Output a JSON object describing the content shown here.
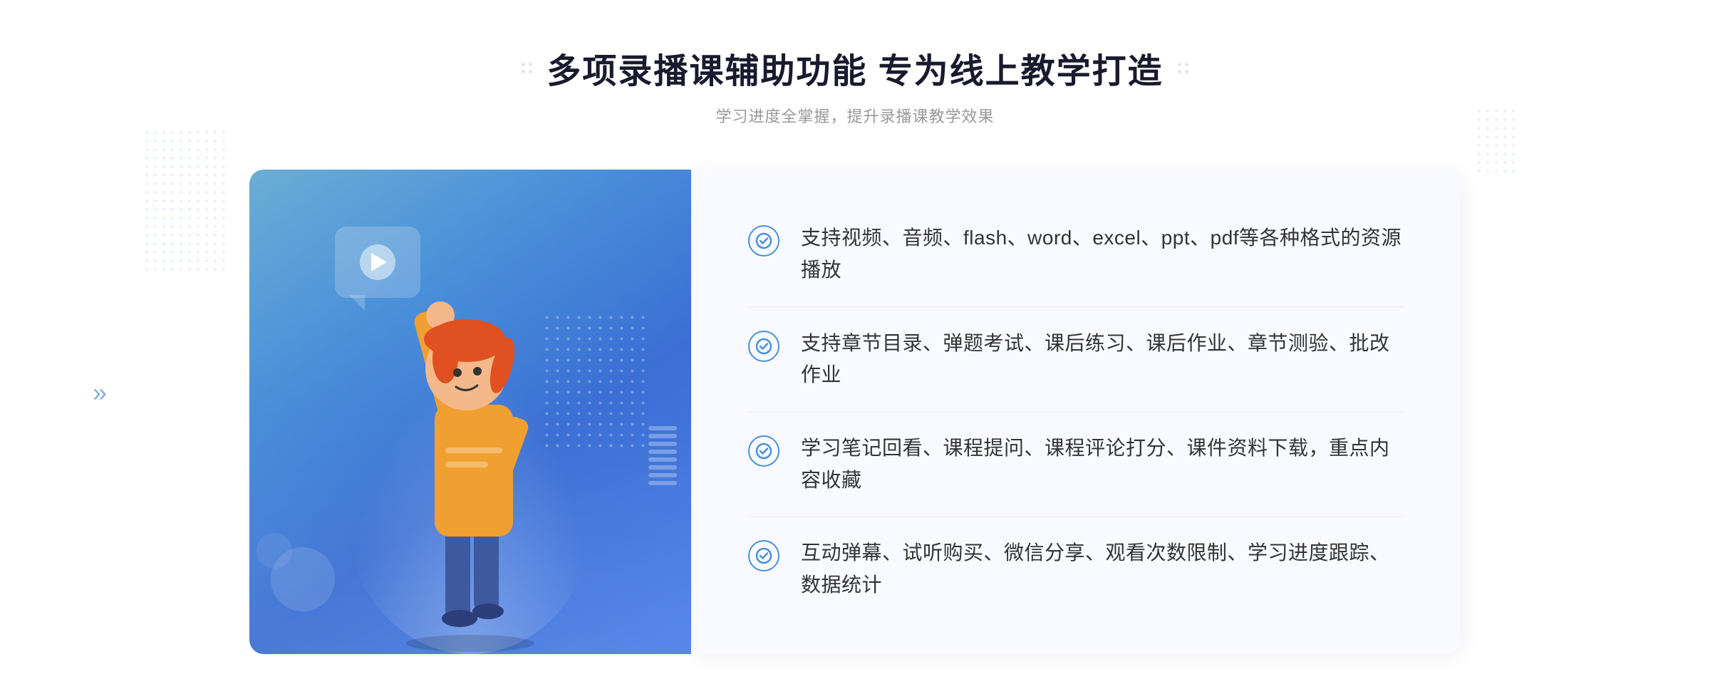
{
  "header": {
    "title": "多项录播课辅助功能 专为线上教学打造",
    "subtitle": "学习进度全掌握，提升录播课教学效果"
  },
  "features": [
    {
      "id": 1,
      "text": "支持视频、音频、flash、word、excel、ppt、pdf等各种格式的资源播放"
    },
    {
      "id": 2,
      "text": "支持章节目录、弹题考试、课后练习、课后作业、章节测验、批改作业"
    },
    {
      "id": 3,
      "text": "学习笔记回看、课程提问、课程评论打分、课件资料下载，重点内容收藏"
    },
    {
      "id": 4,
      "text": "互动弹幕、试听购买、微信分享、观看次数限制、学习进度跟踪、数据统计"
    }
  ],
  "icons": {
    "check": "✓",
    "play": "▶",
    "arrow_right": "»",
    "arrow_dots_left": "∷",
    "arrow_dots_right": "∷"
  },
  "colors": {
    "primary_blue": "#4a90d9",
    "dark_blue": "#3b6fd4",
    "light_bg": "#f8faff",
    "text_dark": "#333333",
    "text_gray": "#999999",
    "accent": "#4a7fe8"
  }
}
